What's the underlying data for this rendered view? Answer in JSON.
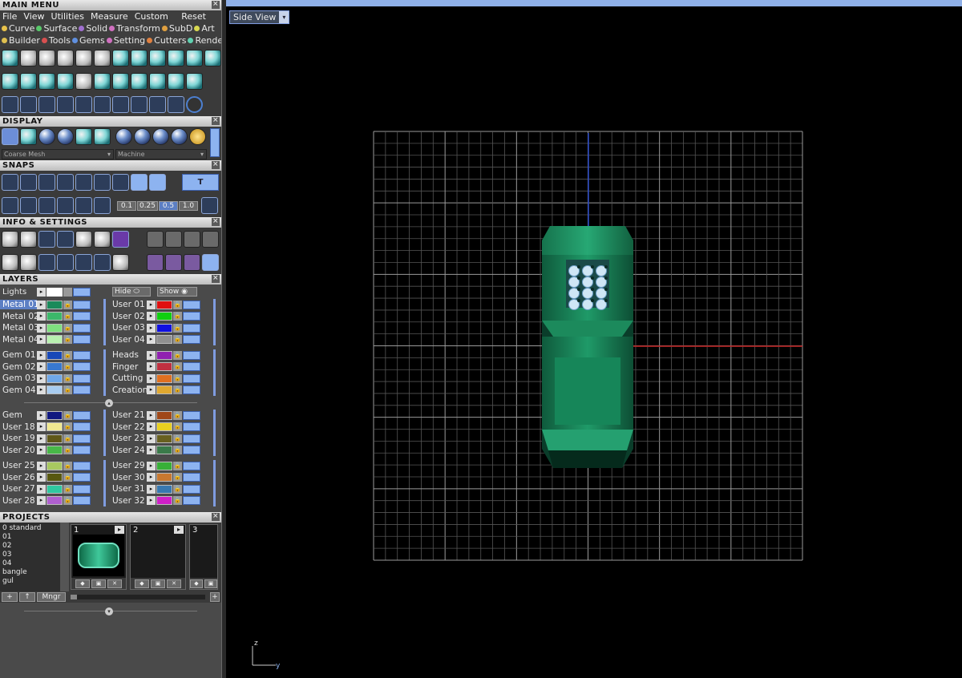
{
  "main_menu": {
    "title": "MAIN MENU",
    "menus": [
      "File",
      "View",
      "Utilities",
      "Measure",
      "Custom"
    ],
    "reset_label": "Reset",
    "categories_row1": [
      {
        "label": "Curve",
        "color": "#e8c24a"
      },
      {
        "label": "Surface",
        "color": "#58c86a"
      },
      {
        "label": "Solid",
        "color": "#a070d0"
      },
      {
        "label": "Transform",
        "color": "#d070c0"
      },
      {
        "label": "SubD",
        "color": "#e0a040"
      },
      {
        "label": "Art",
        "color": "#d8d850"
      }
    ],
    "categories_row2": [
      {
        "label": "Builder",
        "color": "#e0c050"
      },
      {
        "label": "Tools",
        "color": "#d85050"
      },
      {
        "label": "Gems",
        "color": "#6090e0"
      },
      {
        "label": "Setting",
        "color": "#d070c0"
      },
      {
        "label": "Cutters",
        "color": "#e08040"
      },
      {
        "label": "Render",
        "color": "#60d0b0"
      }
    ]
  },
  "display": {
    "title": "DISPLAY",
    "mesh_select": "Coarse Mesh",
    "material_select": "Machine"
  },
  "snaps": {
    "title": "SNAPS",
    "values": [
      "0.1",
      "0.25",
      "0.5",
      "1.0"
    ],
    "selected_value": "0.5"
  },
  "info_settings": {
    "title": "INFO & SETTINGS"
  },
  "layers": {
    "title": "LAYERS",
    "lights_label": "Lights",
    "hide_label": "Hide",
    "show_label": "Show",
    "groups": [
      {
        "left": [
          {
            "name": "Metal 01",
            "color": "#1a8a5a",
            "selected": true
          },
          {
            "name": "Metal 02",
            "color": "#3cb86a"
          },
          {
            "name": "Metal 03",
            "color": "#7fe07f"
          },
          {
            "name": "Metal 04",
            "color": "#b8f0b0"
          }
        ],
        "right": [
          {
            "name": "User 01",
            "color": "#e01010"
          },
          {
            "name": "User 02",
            "color": "#10d010"
          },
          {
            "name": "User 03",
            "color": "#1010e0"
          },
          {
            "name": "User 04",
            "color": "#909090"
          }
        ]
      },
      {
        "left": [
          {
            "name": "Gem 01",
            "color": "#1848b8"
          },
          {
            "name": "Gem 02",
            "color": "#3878d0"
          },
          {
            "name": "Gem 03",
            "color": "#70a8e8"
          },
          {
            "name": "Gem 04",
            "color": "#a8ccf0"
          }
        ],
        "right": [
          {
            "name": "Heads",
            "color": "#9020b0"
          },
          {
            "name": "Finger",
            "color": "#c03040"
          },
          {
            "name": "Cutting",
            "color": "#e07020"
          },
          {
            "name": "Creation",
            "color": "#e0a830"
          }
        ]
      },
      {
        "left": [
          {
            "name": "Gem",
            "color": "#101880"
          },
          {
            "name": "User 18",
            "color": "#f0e890"
          },
          {
            "name": "User 19",
            "color": "#605818"
          },
          {
            "name": "User 20",
            "color": "#48b848"
          }
        ],
        "right": [
          {
            "name": "User 21",
            "color": "#a04818"
          },
          {
            "name": "User 22",
            "color": "#e8d020"
          },
          {
            "name": "User 23",
            "color": "#686020"
          },
          {
            "name": "User 24",
            "color": "#3a7a4a"
          }
        ]
      },
      {
        "left": [
          {
            "name": "User 25",
            "color": "#a8c860"
          },
          {
            "name": "User 26",
            "color": "#585810"
          },
          {
            "name": "User 27",
            "color": "#30c8a0"
          },
          {
            "name": "User 28",
            "color": "#b060d0"
          }
        ],
        "right": [
          {
            "name": "User 29",
            "color": "#38b038"
          },
          {
            "name": "User 30",
            "color": "#c87830"
          },
          {
            "name": "User 31",
            "color": "#3878b0"
          },
          {
            "name": "User 32",
            "color": "#d020c8"
          }
        ]
      }
    ]
  },
  "projects": {
    "title": "PROJECTS",
    "list": [
      "0 standard",
      "01",
      "02",
      "03",
      "04",
      "bangle",
      "gul"
    ],
    "slots": [
      "1",
      "2",
      "3"
    ],
    "manager_label": "Mngr",
    "add_label": "+",
    "up_label": "↑"
  },
  "viewport": {
    "view_label": "Side View",
    "axis_z": "z",
    "axis_y": "y",
    "x_axis_color": "#c02020",
    "vertical_axis_color": "#2040c0",
    "model_color": "#1a8a5a"
  }
}
